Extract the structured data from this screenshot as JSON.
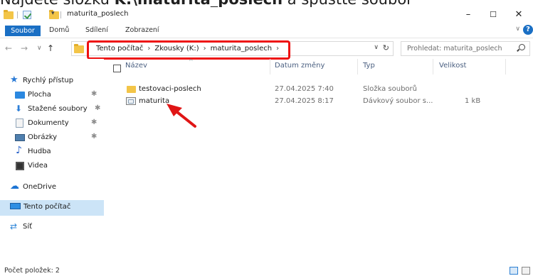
{
  "caption": {
    "pre": "Najděte složku ",
    "bold": "K:\\maturita_poslech",
    "post": " a spusťte soubor"
  },
  "window": {
    "title": "maturita_poslech"
  },
  "ribbon": {
    "tabs": [
      "Soubor",
      "Domů",
      "Sdílení",
      "Zobrazení"
    ]
  },
  "address": {
    "crumbs": [
      "Tento počítač",
      "Zkousky (K:)",
      "maturita_poslech"
    ]
  },
  "search": {
    "placeholder": "Prohledat: maturita_poslech"
  },
  "sidebar": {
    "items": [
      {
        "label": "Rychlý přístup",
        "icon": "star-icon",
        "pinned": false
      },
      {
        "label": "Plocha",
        "icon": "desktop-icon",
        "pinned": true
      },
      {
        "label": "Stažené soubory",
        "icon": "download-icon",
        "pinned": true
      },
      {
        "label": "Dokumenty",
        "icon": "documents-icon",
        "pinned": true
      },
      {
        "label": "Obrázky",
        "icon": "pictures-icon",
        "pinned": true
      },
      {
        "label": "Hudba",
        "icon": "music-icon",
        "pinned": false
      },
      {
        "label": "Videa",
        "icon": "video-icon",
        "pinned": false
      },
      {
        "label": "OneDrive",
        "icon": "cloud-icon",
        "pinned": false
      },
      {
        "label": "Tento počítač",
        "icon": "computer-icon",
        "pinned": false,
        "selected": true
      },
      {
        "label": "Síť",
        "icon": "network-icon",
        "pinned": false
      }
    ]
  },
  "columns": {
    "name": "Název",
    "date": "Datum změny",
    "type": "Typ",
    "size": "Velikost"
  },
  "files": [
    {
      "name": "testovaci-poslech",
      "date": "27.04.2025 7:40",
      "type": "Složka souborů",
      "size": "",
      "icon": "folder-icon"
    },
    {
      "name": "maturita",
      "date": "27.04.2025 8:17",
      "type": "Dávkový soubor s...",
      "size": "1 kB",
      "icon": "batch-file-icon"
    }
  ],
  "status": {
    "count": "Počet položek: 2"
  },
  "colors": {
    "accent": "#1a6fc4",
    "highlight": "#ee1111",
    "selected": "#cce4f7",
    "folder": "#f3c548"
  }
}
